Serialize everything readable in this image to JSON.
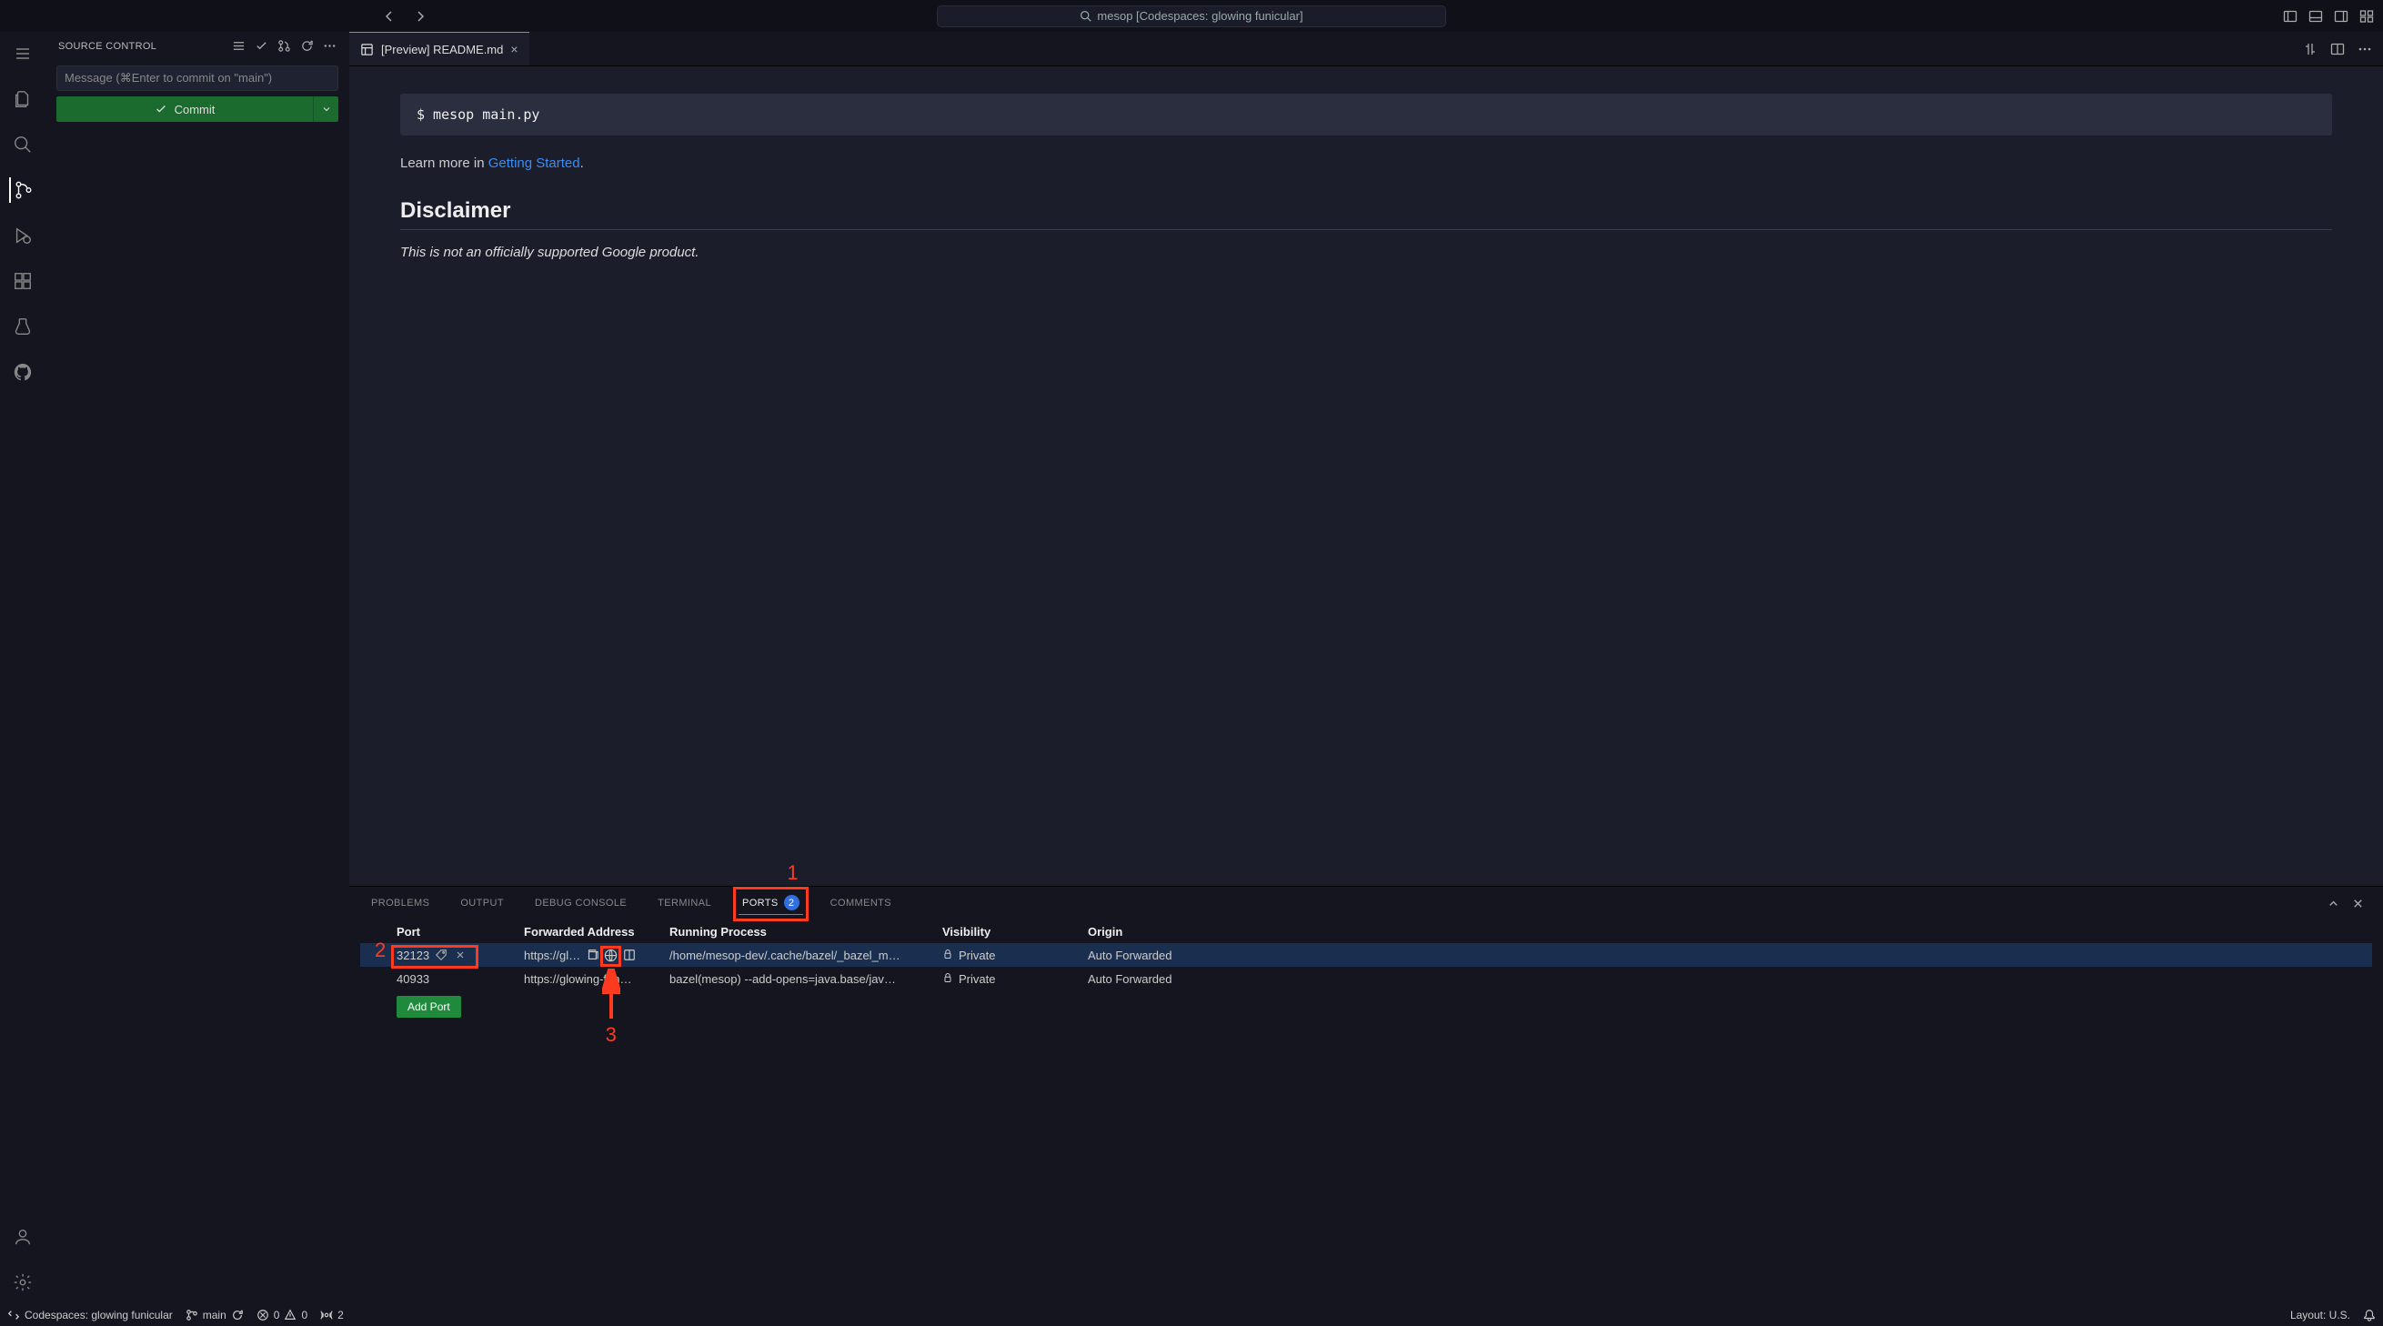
{
  "titlebar": {
    "search_text": "mesop [Codespaces: glowing funicular]"
  },
  "sidebar": {
    "title": "SOURCE CONTROL",
    "commit_placeholder": "Message (⌘Enter to commit on \"main\")",
    "commit_button": "Commit"
  },
  "editor": {
    "tab_label": "[Preview] README.md",
    "code_command": "$ mesop main.py",
    "learn_prefix": "Learn more in ",
    "learn_link_text": "Getting Started",
    "learn_suffix": ".",
    "disclaimer_heading": "Disclaimer",
    "disclaimer_text": "This is not an officially supported Google product."
  },
  "panel": {
    "tabs": {
      "problems": "PROBLEMS",
      "output": "OUTPUT",
      "debug_console": "DEBUG CONSOLE",
      "terminal": "TERMINAL",
      "ports": "PORTS",
      "ports_badge": "2",
      "comments": "COMMENTS"
    },
    "columns": {
      "port": "Port",
      "forwarded_address": "Forwarded Address",
      "running_process": "Running Process",
      "visibility": "Visibility",
      "origin": "Origin"
    },
    "rows": [
      {
        "port": "32123",
        "address": "https://gl…",
        "process": "/home/mesop-dev/.cache/bazel/_bazel_m…",
        "visibility": "Private",
        "origin": "Auto Forwarded",
        "selected": true
      },
      {
        "port": "40933",
        "address": "https://glowing-fun…",
        "process": "bazel(mesop) --add-opens=java.base/jav…",
        "visibility": "Private",
        "origin": "Auto Forwarded",
        "selected": false
      }
    ],
    "add_port_label": "Add Port"
  },
  "statusbar": {
    "codespaces": "Codespaces: glowing funicular",
    "branch": "main",
    "errors": "0",
    "warnings": "0",
    "ports_count": "2",
    "layout": "Layout: U.S."
  },
  "annotations": {
    "n1": "1",
    "n2": "2",
    "n3": "3"
  }
}
